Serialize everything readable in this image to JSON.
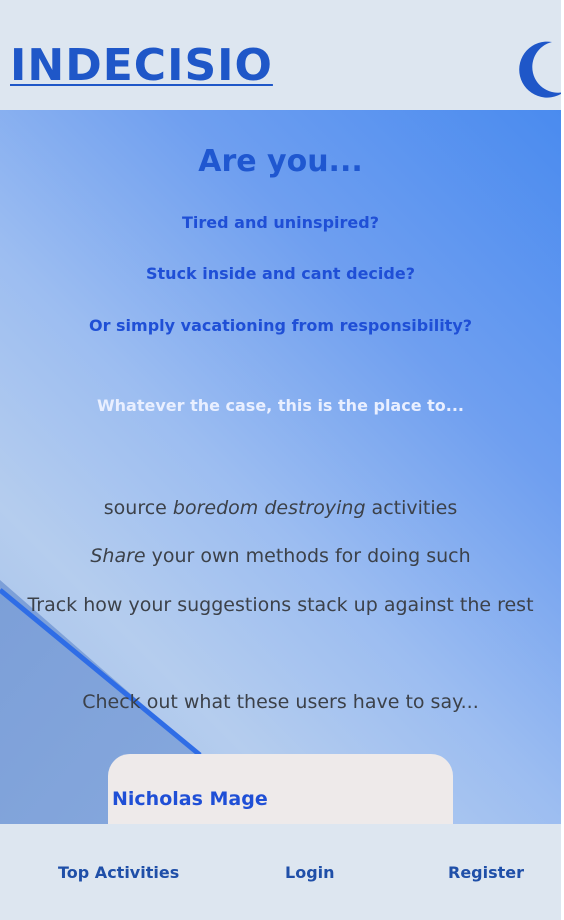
{
  "header": {
    "logo": "INDECISIO",
    "theme_toggle_icon": "moon-icon",
    "accent": "#1f57c8"
  },
  "hero": {
    "title": "Are you...",
    "questions": [
      "Tired and uninspired?",
      "Stuck inside and cant decide?",
      "Or simply vacationing from responsibility?"
    ],
    "whatever": "Whatever the case, this is the place to...",
    "features": [
      {
        "pre": "source ",
        "em": "boredom destroying",
        "post": " activities"
      },
      {
        "pre": "",
        "em": "Share",
        "post": " your own methods for doing such"
      },
      {
        "pre": "Track how your suggestions stack up against the rest",
        "em": "",
        "post": ""
      }
    ],
    "checkout": "Check out what these users have to say..."
  },
  "testimonial": {
    "name": "Nicholas Mage"
  },
  "footer": {
    "top_activities": "Top Activities",
    "login": "Login",
    "register": "Register"
  }
}
